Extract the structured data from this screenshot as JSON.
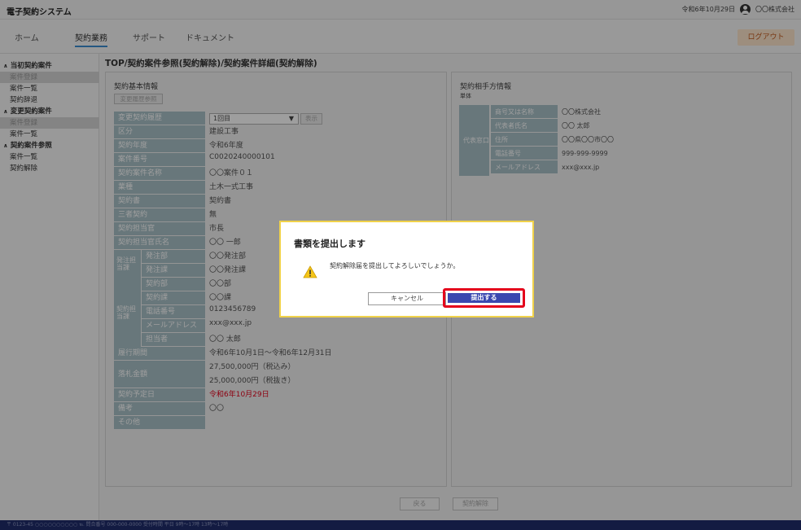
{
  "app_title": "電子契約システム",
  "header": {
    "date": "令和6年10月29日",
    "company": "〇〇株式会社",
    "logout_label": "ログアウト"
  },
  "nav": [
    "ホーム",
    "契約業務",
    "サポート",
    "ドキュメント"
  ],
  "sidebar": {
    "groups": [
      {
        "label": "当初契約案件",
        "items": [
          "案件登録",
          "案件一覧",
          "契約辞退"
        ]
      },
      {
        "label": "変更契約案件",
        "items": [
          "案件登録",
          "案件一覧"
        ]
      },
      {
        "label": "契約案件参照",
        "items": [
          "案件一覧",
          "契約解除"
        ]
      }
    ]
  },
  "breadcrumb": "TOP/契約案件参照(契約解除)/契約案件詳細(契約解除)",
  "basic": {
    "title": "契約基本情報",
    "change_history_button": "変更履歴参照",
    "history_select": "1回目",
    "display_button": "表示",
    "rows": [
      {
        "label": "変更契約履歴",
        "value": ""
      },
      {
        "label": "区分",
        "value": "建設工事"
      },
      {
        "label": "契約年度",
        "value": "令和6年度"
      },
      {
        "label": "案件番号",
        "value": "C0020240000101"
      },
      {
        "label": "契約案件名称",
        "value": "〇〇案件０１"
      },
      {
        "label": "業種",
        "value": "土木一式工事"
      },
      {
        "label": "契約書",
        "value": "契約書"
      },
      {
        "label": "三者契約",
        "value": "無"
      },
      {
        "label": "契約担当官",
        "value": "市長"
      },
      {
        "label": "契約担当官氏名",
        "value": "〇〇 一郎"
      }
    ],
    "order_group": {
      "label": "発注担当課",
      "rows": [
        {
          "label": "発注部",
          "value": "〇〇発注部"
        },
        {
          "label": "発注課",
          "value": "〇〇発注課"
        }
      ]
    },
    "contract_group": {
      "label": "契約担当課",
      "rows": [
        {
          "label": "契約部",
          "value": "〇〇部"
        },
        {
          "label": "契約課",
          "value": "〇〇課"
        },
        {
          "label": "電話番号",
          "value": "0123456789"
        },
        {
          "label": "メールアドレス",
          "value": "xxx@xxx.jp"
        },
        {
          "label": "担当者",
          "value": "〇〇 太郎"
        }
      ]
    },
    "period": {
      "label": "履行期間",
      "value": "令和6年10月1日～令和6年12月31日"
    },
    "amount": {
      "label": "落札金額",
      "tax_in": "27,500,000円（税込み）",
      "tax_ex": "25,000,000円（税抜き）"
    },
    "tail_rows": [
      {
        "label": "契約予定日",
        "value": "令和6年10月29日",
        "red": true
      },
      {
        "label": "備考",
        "value": "〇〇"
      },
      {
        "label": "その他",
        "value": ""
      }
    ]
  },
  "partner": {
    "title": "契約相手方情報",
    "subtitle": "単体",
    "group_label": "代表窓口",
    "rows": [
      {
        "label": "商号又は名称",
        "value": "〇〇株式会社"
      },
      {
        "label": "代表者氏名",
        "value": "〇〇 太郎"
      },
      {
        "label": "住所",
        "value": "〇〇県〇〇市〇〇"
      },
      {
        "label": "電話番号",
        "value": "999-999-9999"
      },
      {
        "label": "メールアドレス",
        "value": "xxx@xxx.jp"
      }
    ]
  },
  "footer_buttons": {
    "back": "戻る",
    "cancel_contract": "契約解除"
  },
  "statusbar": "〒 0123-45 ○○○○○○○○○○  ℡ 問合番号 000-000-0000  受付時間 平日 9時～17時 13時～17時",
  "dialog": {
    "title": "書類を提出します",
    "message": "契約解除届を提出してよろしいでしょうか。",
    "cancel_label": "キャンセル",
    "submit_label": "提出する"
  },
  "colors": {
    "label_bg": "#a9c0c7",
    "accent_blue": "#3a48b0",
    "highlight_red": "#e4001b",
    "statusbar": "#1f2d6b",
    "dialog_border": "#f0d24a"
  }
}
